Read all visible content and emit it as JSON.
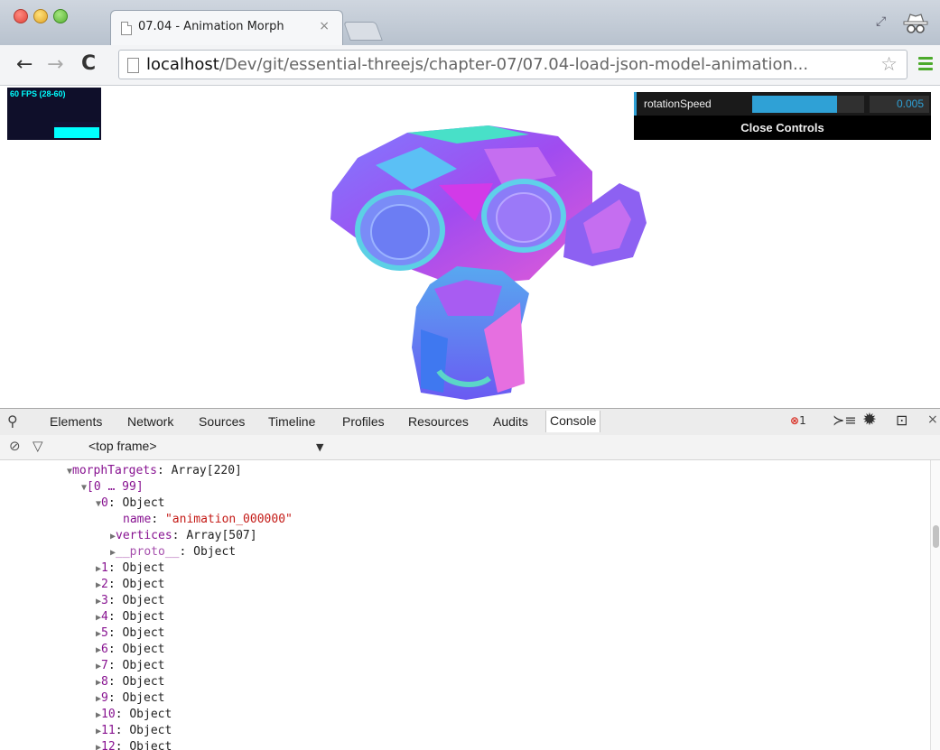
{
  "browser": {
    "tab_title": "07.04 - Animation Morph",
    "tab_close": "×",
    "url_host": "localhost",
    "url_path": "/Dev/git/essential-threejs/chapter-07/07.04-load-json-model-animation..."
  },
  "icons": {
    "back": "←",
    "forward": "→",
    "reload": "C",
    "star": "☆",
    "search": "🔍",
    "exec": "≻≡",
    "gear": "✹",
    "dock": "⊡",
    "close": "×",
    "clear": "⊘",
    "filter": "▽",
    "dropdown": "▼"
  },
  "stats": {
    "label": "60 FPS (28-60)"
  },
  "gui": {
    "label": "rotationSpeed",
    "value": "0.005",
    "slider_fraction": 0.76,
    "close_label": "Close Controls"
  },
  "devtools": {
    "tabs": [
      "Elements",
      "Network",
      "Sources",
      "Timeline",
      "Profiles",
      "Resources",
      "Audits",
      "Console"
    ],
    "active_tab": "Console",
    "error_count": "1",
    "frame_label": "<top frame>"
  },
  "console": {
    "morph_targets": {
      "key": "morphTargets",
      "value": "Array[220]"
    },
    "range": "[0 … 99]",
    "item0": {
      "key": "0",
      "value": "Object"
    },
    "name": {
      "key": "name",
      "value": "\"animation_000000\""
    },
    "vertices": {
      "key": "vertices",
      "value": "Array[507]"
    },
    "proto": {
      "key": "__proto__",
      "value": "Object"
    },
    "items": [
      {
        "key": "1",
        "value": "Object"
      },
      {
        "key": "2",
        "value": "Object"
      },
      {
        "key": "3",
        "value": "Object"
      },
      {
        "key": "4",
        "value": "Object"
      },
      {
        "key": "5",
        "value": "Object"
      },
      {
        "key": "6",
        "value": "Object"
      },
      {
        "key": "7",
        "value": "Object"
      },
      {
        "key": "8",
        "value": "Object"
      },
      {
        "key": "9",
        "value": "Object"
      },
      {
        "key": "10",
        "value": "Object"
      },
      {
        "key": "11",
        "value": "Object"
      },
      {
        "key": "12",
        "value": "Object"
      }
    ]
  },
  "colors": {
    "gui_accent": "#2fa1d6",
    "stats_fg": "#00ffff",
    "console_key": "#881391",
    "console_string": "#c41a16",
    "menu_green": "#4caa2c"
  }
}
